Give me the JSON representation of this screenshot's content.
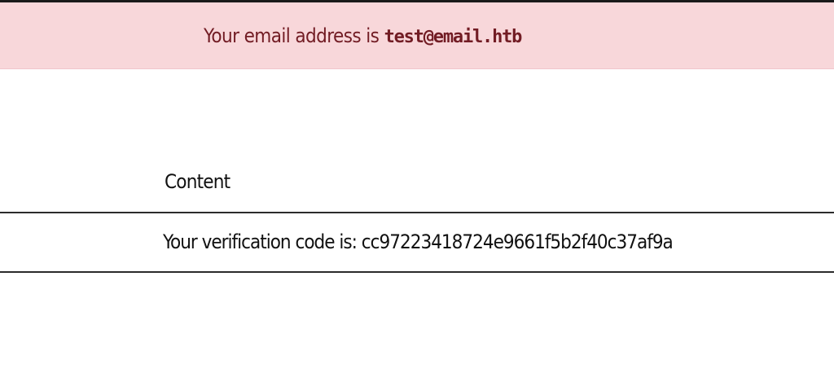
{
  "alert": {
    "prefix": "Your email address is ",
    "email": "test@email.htb"
  },
  "table": {
    "header": "Content",
    "rows": [
      {
        "content": "Your verification code is: cc97223418724e9661f5b2f40c37af9a"
      }
    ]
  },
  "colors": {
    "alert_background": "#f8d7da",
    "alert_text": "#721c24",
    "rule": "#2b2b2b"
  }
}
